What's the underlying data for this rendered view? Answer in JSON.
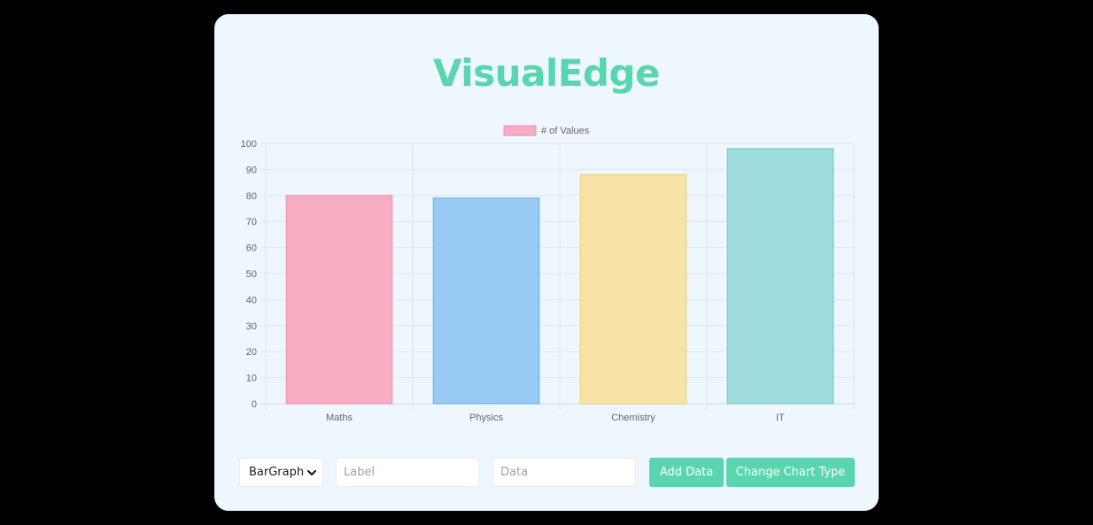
{
  "app": {
    "title": "VisualEdge"
  },
  "colors": {
    "accent": "#5ad6ae",
    "card_background": "#eef6fe",
    "page_background": "#000000"
  },
  "controls": {
    "chart_type_select": {
      "selected": "BarGraph",
      "caret_icon": "chevron-down-icon"
    },
    "label_input": {
      "placeholder": "Label",
      "value": ""
    },
    "data_input": {
      "placeholder": "Data",
      "value": ""
    },
    "add_data_label": "Add Data",
    "change_chart_type_label": "Change Chart Type"
  },
  "chart_data": {
    "type": "bar",
    "legend": {
      "label": "# of Values",
      "placement": "top-center"
    },
    "categories": [
      "Maths",
      "Physics",
      "Chemistry",
      "IT"
    ],
    "values": [
      80,
      79,
      88,
      98
    ],
    "fill_colors": [
      "#f7aec3",
      "#97cbf3",
      "#f7e2a8",
      "#9edcdd"
    ],
    "border_colors": [
      "#f08aa6",
      "#5aaee8",
      "#f2cc6a",
      "#66c8c8"
    ],
    "ylim": [
      0,
      100
    ],
    "yticks": [
      0,
      10,
      20,
      30,
      40,
      50,
      60,
      70,
      80,
      90,
      100
    ],
    "grid": true,
    "xlabel": "",
    "ylabel": ""
  }
}
